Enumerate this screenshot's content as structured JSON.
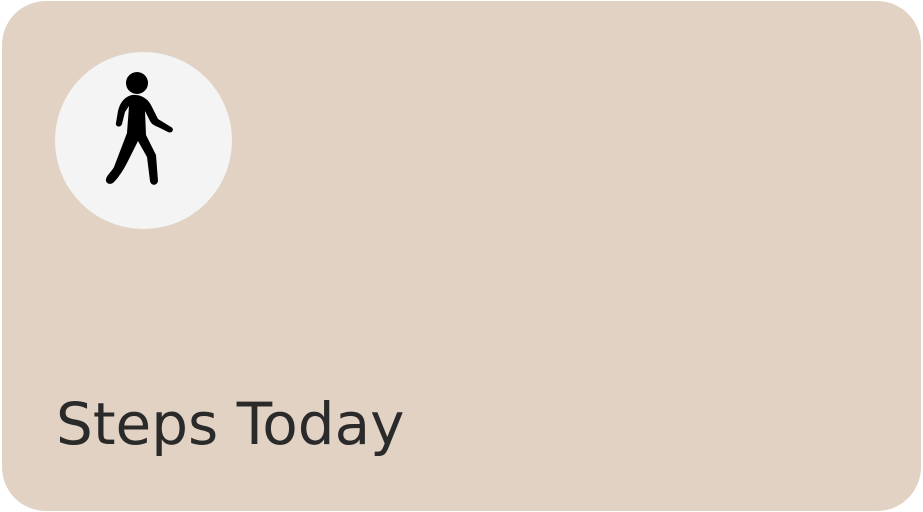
{
  "card": {
    "title": "Steps Today",
    "icon": "walking-person-icon",
    "background_color": "#e1d2c4",
    "icon_badge_color": "#f4f4f4"
  }
}
